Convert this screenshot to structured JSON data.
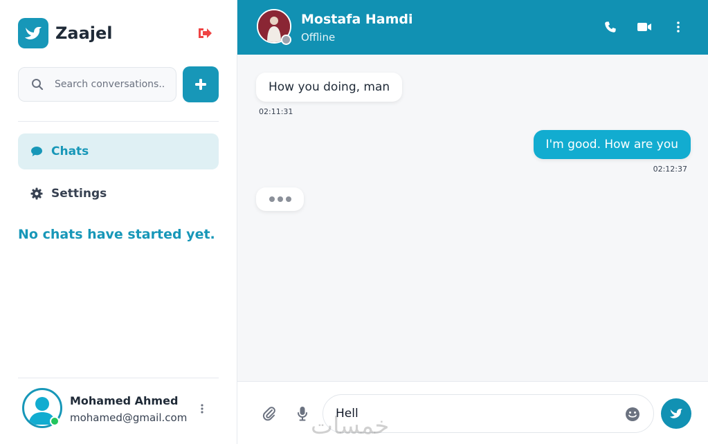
{
  "app": {
    "name": "Zaajel",
    "brand_color": "#1797b8",
    "logout_icon": "logout-icon"
  },
  "sidebar": {
    "search_placeholder": "Search conversations...",
    "add_icon": "plus-icon",
    "nav": [
      {
        "label": "Chats",
        "icon": "chat-bubble-icon",
        "active": true
      },
      {
        "label": "Settings",
        "icon": "gear-icon",
        "active": false
      }
    ],
    "empty_message": "No chats have started yet.",
    "user": {
      "name": "Mohamed Ahmed",
      "email": "mohamed@gmail.com",
      "status": "online",
      "status_color": "#22c55e"
    }
  },
  "chat": {
    "contact": {
      "name": "Mostafa Hamdi",
      "status": "Offline",
      "status_color": "#9ca3af"
    },
    "header_actions": [
      "phone-icon",
      "video-icon",
      "more-vertical-icon"
    ],
    "messages": [
      {
        "direction": "in",
        "text": "How you doing, man",
        "time": "02:11:31"
      },
      {
        "direction": "out",
        "text": "I'm good. How are you",
        "time": "02:12:37"
      }
    ],
    "typing_indicator": true,
    "composer": {
      "value": "Hell",
      "attach_icon": "paperclip-icon",
      "mic_icon": "microphone-icon",
      "emoji_icon": "smiley-icon",
      "send_icon": "bird-send-icon"
    },
    "watermark": "خمسات"
  }
}
